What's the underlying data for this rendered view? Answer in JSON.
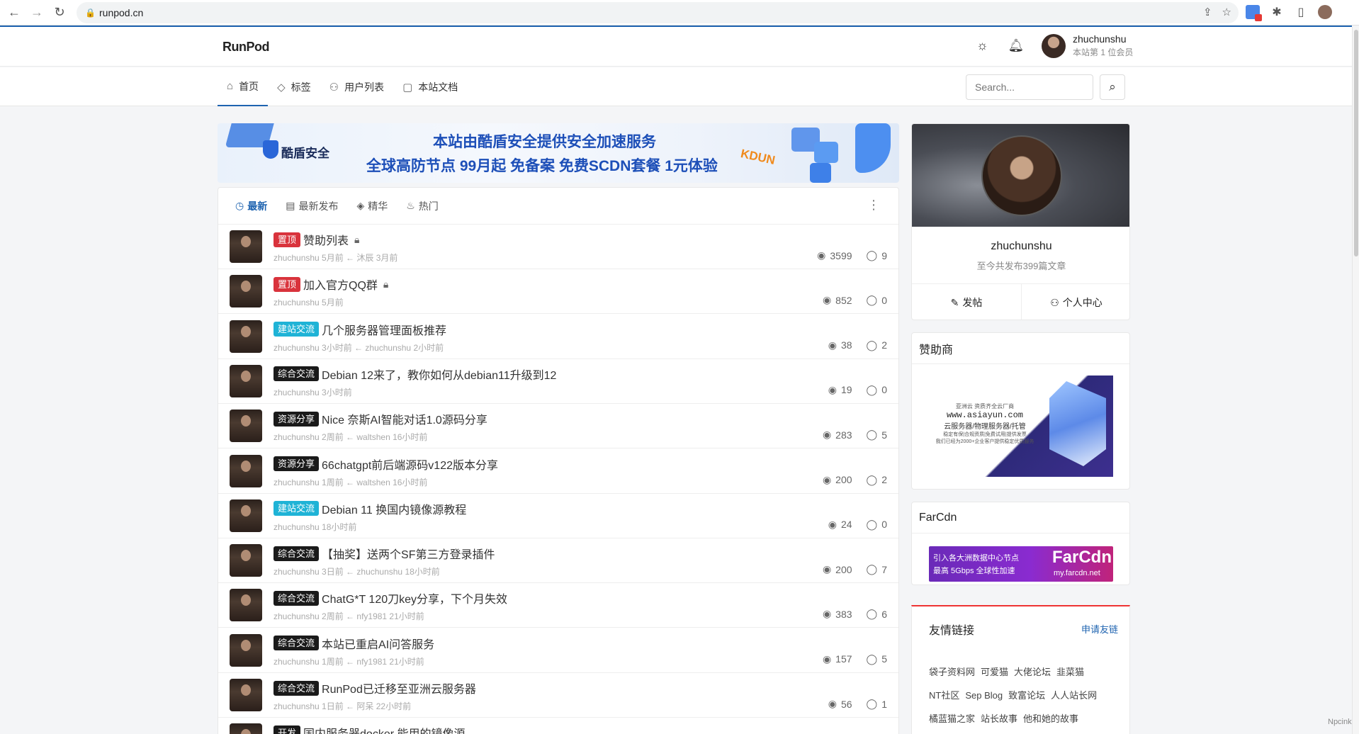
{
  "browser": {
    "url": "runpod.cn"
  },
  "site": {
    "logo": "RunPod",
    "user_name": "zhuchunshu",
    "user_rank": "本站第 1 位会员",
    "nav": [
      "首页",
      "标签",
      "用户列表",
      "本站文档"
    ],
    "search_placeholder": "Search..."
  },
  "banner": {
    "brand": "酷盾安全",
    "line1": "本站由酷盾安全提供安全加速服务",
    "line2": "全球高防节点 99月起 免备案  免费SCDN套餐 1元体验",
    "badge": "KDUN"
  },
  "feed": {
    "tabs": [
      "最新",
      "最新发布",
      "精华",
      "热门"
    ],
    "topics": [
      {
        "tag": "置顶",
        "tag_color": "#d9333c",
        "title": "赞助列表",
        "locked": true,
        "meta": "zhuchunshu 5月前 ← 沐辰 3月前",
        "views": "3599",
        "comments": "9"
      },
      {
        "tag": "置顶",
        "tag_color": "#d9333c",
        "title": "加入官方QQ群",
        "locked": true,
        "meta": "zhuchunshu 5月前",
        "views": "852",
        "comments": "0"
      },
      {
        "tag": "建站交流",
        "tag_color": "#1fb3d6",
        "title": "几个服务器管理面板推荐",
        "locked": false,
        "meta": "zhuchunshu 3小时前 ← zhuchunshu 2小时前",
        "views": "38",
        "comments": "2"
      },
      {
        "tag": "综合交流",
        "tag_color": "#1a1a1a",
        "title": "Debian 12来了，教你如何从debian11升级到12",
        "locked": false,
        "meta": "zhuchunshu 3小时前",
        "views": "19",
        "comments": "0"
      },
      {
        "tag": "资源分享",
        "tag_color": "#1a1a1a",
        "title": "Nice 奈斯AI智能对话1.0源码分享",
        "locked": false,
        "meta": "zhuchunshu 2周前 ← waltshen 16小时前",
        "views": "283",
        "comments": "5"
      },
      {
        "tag": "资源分享",
        "tag_color": "#1a1a1a",
        "title": "66chatgpt前后端源码v122版本分享",
        "locked": false,
        "meta": "zhuchunshu 1周前 ← waltshen 16小时前",
        "views": "200",
        "comments": "2"
      },
      {
        "tag": "建站交流",
        "tag_color": "#1fb3d6",
        "title": "Debian 11 换国内镜像源教程",
        "locked": false,
        "meta": "zhuchunshu 18小时前",
        "views": "24",
        "comments": "0"
      },
      {
        "tag": "综合交流",
        "tag_color": "#1a1a1a",
        "title": "【抽奖】送两个SF第三方登录插件",
        "locked": false,
        "meta": "zhuchunshu 3日前 ← zhuchunshu 18小时前",
        "views": "200",
        "comments": "7"
      },
      {
        "tag": "综合交流",
        "tag_color": "#1a1a1a",
        "title": "ChatG*T 120刀key分享，下个月失效",
        "locked": false,
        "meta": "zhuchunshu 2周前 ← nfy1981 21小时前",
        "views": "383",
        "comments": "6"
      },
      {
        "tag": "综合交流",
        "tag_color": "#1a1a1a",
        "title": "本站已重启AI问答服务",
        "locked": false,
        "meta": "zhuchunshu 1周前 ← nfy1981 21小时前",
        "views": "157",
        "comments": "5"
      },
      {
        "tag": "综合交流",
        "tag_color": "#1a1a1a",
        "title": "RunPod已迁移至亚洲云服务器",
        "locked": false,
        "meta": "zhuchunshu 1日前 ← 阿呆 22小时前",
        "views": "56",
        "comments": "1"
      },
      {
        "tag": "开发",
        "tag_color": "#1a1a1a",
        "title": "国内服务器docker 能用的镜像源",
        "locked": false,
        "meta": "",
        "views": "",
        "comments": ""
      }
    ]
  },
  "profile": {
    "name": "zhuchunshu",
    "sub": "至今共发布399篇文章",
    "post_btn": "发帖",
    "center_btn": "个人中心"
  },
  "sponsor": {
    "title": "赞助商",
    "ad_t1": "亚洲云 资质齐全云厂商",
    "ad_t2": "www.asiayun.com",
    "ad_t3": "云服务器/物理服务器/托管",
    "ad_t4": "稳定有保|合规资质|免费试用|提供发票",
    "ad_t5": "我们已经为2000+企业客户提供稳定优质服务"
  },
  "farcdn": {
    "title": "FarCdn",
    "l1": "引入各大洲数据中心节点",
    "l2": "最高 5Gbps 全球性加速",
    "brand": "FarCdn",
    "domain": "my.farcdn.net"
  },
  "links": {
    "title": "友情链接",
    "apply": "申请友链",
    "rows": [
      [
        "袋子资料网",
        "可爱猫",
        "大佬论坛",
        "韭菜猫"
      ],
      [
        "NT社区",
        "Sep Blog",
        "致富论坛",
        "人人站长网"
      ],
      [
        "橘蓝猫之家",
        "站长故事",
        "他和她的故事"
      ]
    ]
  },
  "footer_mark": "Npcink"
}
